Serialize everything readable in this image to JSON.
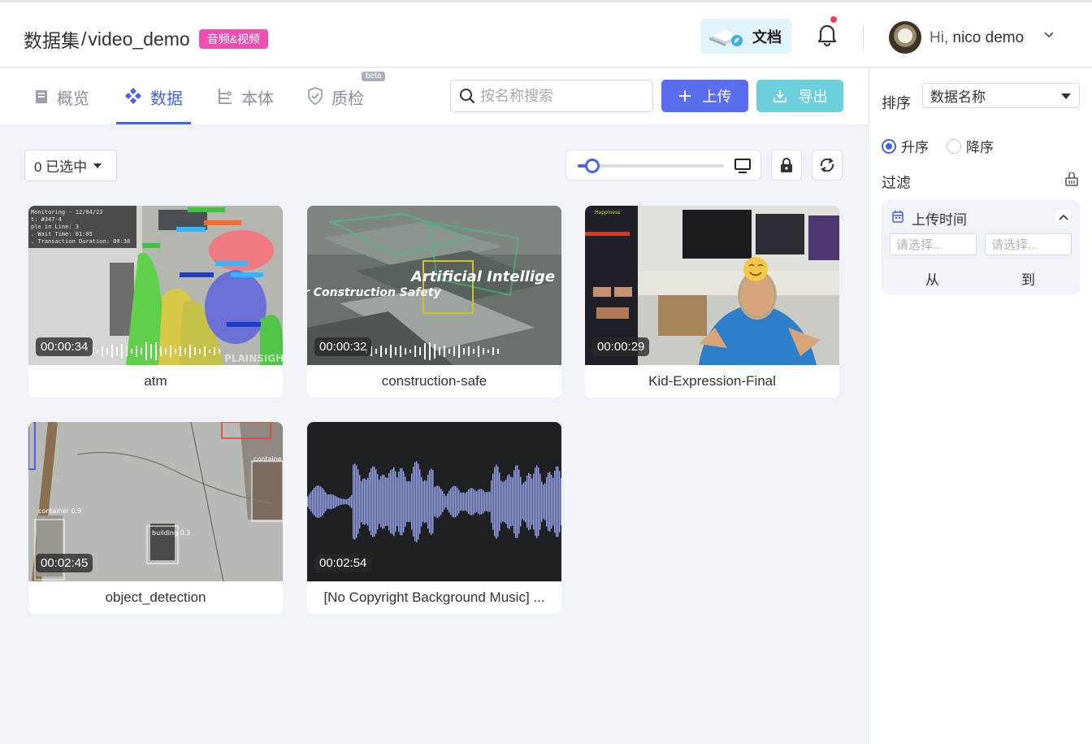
{
  "header": {
    "breadcrumb_root": "数据集",
    "separator": "/",
    "dataset_name": "video_demo",
    "badge": "音频&视频",
    "docs_label": "文档",
    "greeting_prefix": "Hi,",
    "username": "nico demo"
  },
  "tabs": [
    {
      "label": "概览",
      "icon": "book-icon"
    },
    {
      "label": "数据",
      "icon": "diamond-icon",
      "active": true
    },
    {
      "label": "本体",
      "icon": "tree-icon"
    },
    {
      "label": "质检",
      "icon": "shield-icon",
      "tag": "beta"
    }
  ],
  "search": {
    "placeholder": "按名称搜索",
    "value": ""
  },
  "toolbar": {
    "upload_label": "上传",
    "export_label": "导出"
  },
  "selection": {
    "label": "0 已选中"
  },
  "size_slider": {
    "value": 0.1
  },
  "cards": [
    {
      "name": "atm",
      "duration": "00:00:34"
    },
    {
      "name": "construction-safe",
      "duration": "00:00:32"
    },
    {
      "name": "Kid-Expression-Final",
      "duration": "00:00:29"
    },
    {
      "name": "object_detection",
      "duration": "00:02:45"
    },
    {
      "name": "[No Copyright Background Music] ...",
      "duration": "00:02:54"
    }
  ],
  "thumbnail_text": {
    "atm_lines": [
      "Monitoring - 12/04/23",
      "t: #347-4",
      "ple in Line: 3",
      ". Wait Time: 01:05",
      ". Transaction Duration: 00:38"
    ],
    "atm_watermark": "PLAINSIGH",
    "construction_line1": "Artificial Intellige",
    "construction_line2": "r Construction Safety",
    "kid_label": "Happiness",
    "od_label1": "container 0.9",
    "od_label2": "building 0.3",
    "od_label3": "containe"
  },
  "sidebar": {
    "sort_label": "排序",
    "sort_value": "数据名称",
    "asc_label": "升序",
    "desc_label": "降序",
    "filter_label": "过滤",
    "upload_time_label": "上传时间",
    "from_placeholder": "请选择...",
    "to_placeholder": "请选择...",
    "from_label": "从",
    "to_label": "到"
  },
  "colors": {
    "primary": "#4a63e3",
    "upload": "#5b6ef0",
    "export": "#6dd0de",
    "badge": "#ec4fae"
  }
}
